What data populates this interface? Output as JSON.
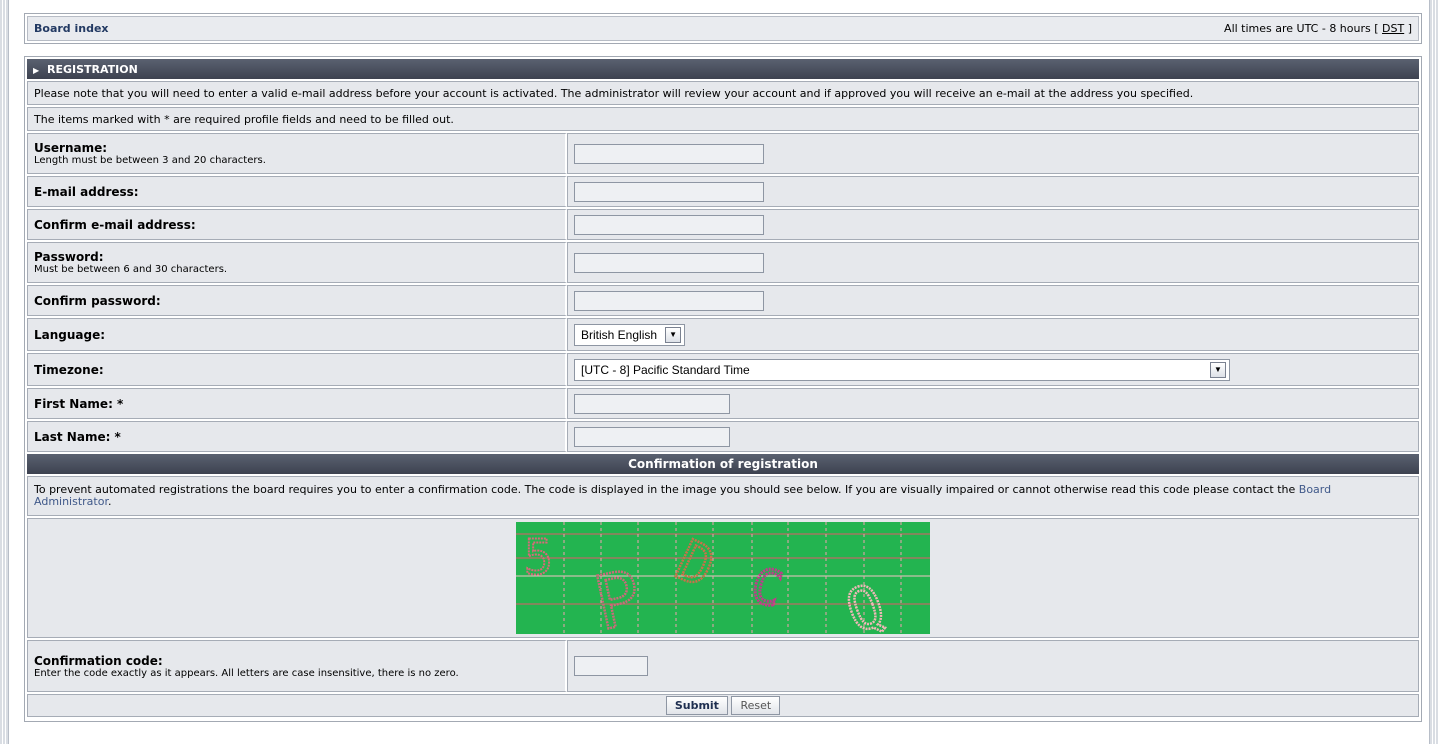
{
  "nav": {
    "board_index": "Board index",
    "timezone_note": "All times are UTC - 8 hours [",
    "dst": "DST",
    "close": "]"
  },
  "registration": {
    "header": "REGISTRATION",
    "notice": "Please note that you will need to enter a valid e-mail address before your account is activated. The administrator will review your account and if approved you will receive an e-mail at the address you specified.",
    "required_note": "The items marked with * are required profile fields and need to be filled out.",
    "fields": {
      "username": {
        "label": "Username:",
        "hint": "Length must be between 3 and 20 characters.",
        "value": ""
      },
      "email": {
        "label": "E-mail address:",
        "value": ""
      },
      "confirm_email": {
        "label": "Confirm e-mail address:",
        "value": ""
      },
      "password": {
        "label": "Password:",
        "hint": "Must be between 6 and 30 characters.",
        "value": ""
      },
      "confirm_password": {
        "label": "Confirm password:",
        "value": ""
      },
      "language": {
        "label": "Language:",
        "selected": "British English"
      },
      "timezone": {
        "label": "Timezone:",
        "selected": "[UTC - 8] Pacific Standard Time"
      },
      "first_name": {
        "label": "First Name: *",
        "value": ""
      },
      "last_name": {
        "label": "Last Name: *",
        "value": ""
      }
    }
  },
  "confirmation": {
    "header": "Confirmation of registration",
    "description": "To prevent automated registrations the board requires you to enter a confirmation code. The code is displayed in the image you should see below. If you are visually impaired or cannot otherwise read this code please contact the",
    "admin_link": "Board Administrator",
    "period": ".",
    "captcha_chars": [
      "5",
      "P",
      "D",
      "C",
      "Q"
    ],
    "code_label": "Confirmation code:",
    "code_hint": "Enter the code exactly as it appears. All letters are case insensitive, there is no zero.",
    "code_value": ""
  },
  "buttons": {
    "submit": "Submit",
    "reset": "Reset"
  }
}
